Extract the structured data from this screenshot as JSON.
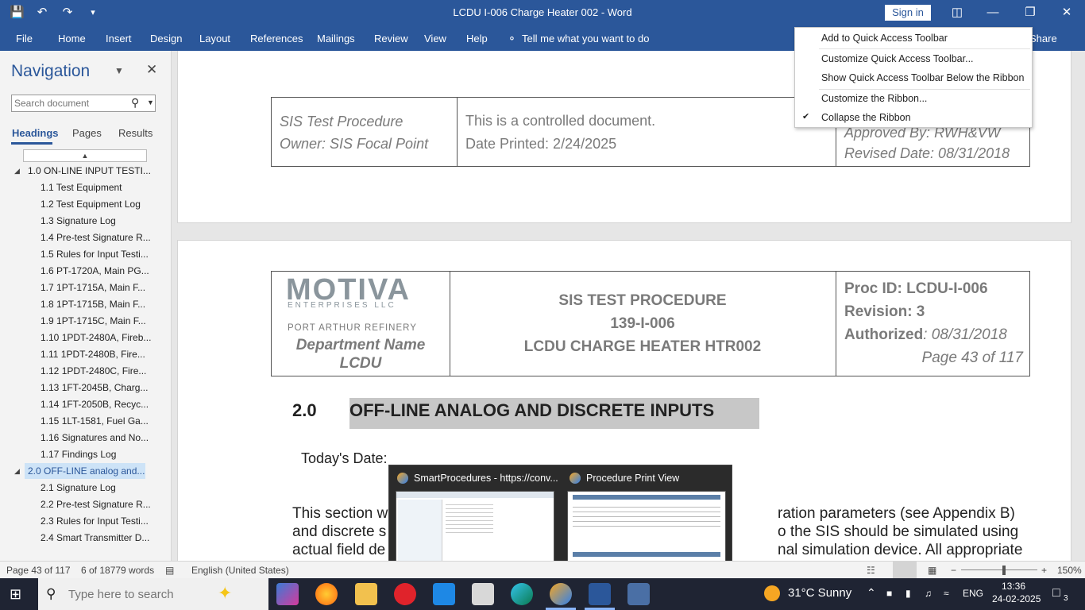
{
  "window": {
    "title": "LCDU I-006 Charge Heater 002  -  Word",
    "sign_in": "Sign in",
    "quick_access": [
      "save-icon",
      "undo-icon",
      "redo-icon",
      "customize-qat-icon"
    ]
  },
  "ribbon": {
    "tabs": [
      "File",
      "Home",
      "Insert",
      "Design",
      "Layout",
      "References",
      "Mailings",
      "Review",
      "View",
      "Help"
    ],
    "tell_me": "Tell me what you want to do",
    "share": "Share"
  },
  "navigation": {
    "title": "Navigation",
    "search_placeholder": "Search document",
    "tabs": [
      "Headings",
      "Pages",
      "Results"
    ],
    "headings": [
      {
        "label": "1.0 ON-LINE INPUT TESTI...",
        "level": 1,
        "expanded": true
      },
      {
        "label": "1.1 Test Equipment",
        "level": 2
      },
      {
        "label": "1.2 Test Equipment Log",
        "level": 2
      },
      {
        "label": "1.3 Signature Log",
        "level": 2
      },
      {
        "label": "1.4 Pre-test Signature R...",
        "level": 2
      },
      {
        "label": "1.5 Rules for Input Testi...",
        "level": 2
      },
      {
        "label": "1.6 PT-1720A, Main PG...",
        "level": 2
      },
      {
        "label": "1.7 1PT-1715A, Main F...",
        "level": 2
      },
      {
        "label": "1.8 1PT-1715B, Main F...",
        "level": 2
      },
      {
        "label": "1.9 1PT-1715C,    Main F...",
        "level": 2
      },
      {
        "label": "1.10 1PDT-2480A, Fireb...",
        "level": 2
      },
      {
        "label": "1.11 1PDT-2480B,    Fire...",
        "level": 2
      },
      {
        "label": "1.12 1PDT-2480C,    Fire...",
        "level": 2
      },
      {
        "label": "1.13 1FT-2045B,    Charg...",
        "level": 2
      },
      {
        "label": "1.14 1FT-2050B,    Recyc...",
        "level": 2
      },
      {
        "label": "1.15 1LT-1581,   Fuel Ga...",
        "level": 2
      },
      {
        "label": "1.16 Signatures and No...",
        "level": 2
      },
      {
        "label": "1.17 Findings Log",
        "level": 2
      },
      {
        "label": "2.0 OFF-LINE analog and...",
        "level": 1,
        "expanded": true,
        "selected": true
      },
      {
        "label": "2.1 Signature Log",
        "level": 2
      },
      {
        "label": "2.2 Pre-test Signature R...",
        "level": 2
      },
      {
        "label": "2.3 Rules for Input Testi...",
        "level": 2
      },
      {
        "label": "2.4 Smart Transmitter D...",
        "level": 2
      }
    ]
  },
  "document": {
    "page1_header": {
      "left_line1": "SIS Test Procedure",
      "left_line2": "Owner: SIS Focal Point",
      "mid_line1": "This is a controlled document.",
      "mid_line2": "Date Printed: 2/24/2025",
      "right_line1": "Approved By: RWH&VW",
      "right_line2": "Revised Date: 08/31/2018"
    },
    "page2_header": {
      "logo_main": "MOTIVA",
      "logo_sub": "ENTERPRISES LLC",
      "refinery": "PORT ARTHUR REFINERY",
      "dept_line1": "Department Name",
      "dept_line2": "LCDU",
      "title_line1": "SIS TEST PROCEDURE",
      "title_line2": "139-I-006",
      "title_line3": "LCDU CHARGE HEATER HTR002",
      "proc_id": "Proc ID: LCDU-I-006",
      "revision": "Revision: 3",
      "authorized_label": "Authorized",
      "authorized_value": ": 08/31/2018",
      "page_of": "Page 43 of 117"
    },
    "section_number": "2.0",
    "section_title": "OFF-LINE ANALOG AND DISCRETE INPUTS",
    "todays_date": "Today's Date:",
    "body_line1_start": "This section w",
    "body_line1_end": "ration parameters (see Appendix B)",
    "body_line2_start": "and discrete s",
    "body_line2_end": "o the SIS should be simulated using",
    "body_line3_start": "actual field de",
    "body_line3_end": "nal simulation device. All appropriate"
  },
  "context_menu": {
    "items": [
      "Add to Quick Access Toolbar",
      "Customize Quick Access Toolbar...",
      "Show Quick Access Toolbar Below the Ribbon",
      "Customize the Ribbon...",
      "Collapse the Ribbon"
    ],
    "checked_index": 4
  },
  "taskbar_preview": {
    "windows": [
      "SmartProcedures - https://conv...",
      "Procedure Print View"
    ]
  },
  "statusbar": {
    "page": "Page 43 of 117",
    "words": "6 of 18779 words",
    "language": "English (United States)",
    "zoom": "150%",
    "zoom_level": 1.5
  },
  "taskbar": {
    "search_placeholder": "Type here to search",
    "weather": "31°C  Sunny",
    "language": "ENG",
    "time": "13:36",
    "date": "24-02-2025",
    "notifications": "3"
  }
}
